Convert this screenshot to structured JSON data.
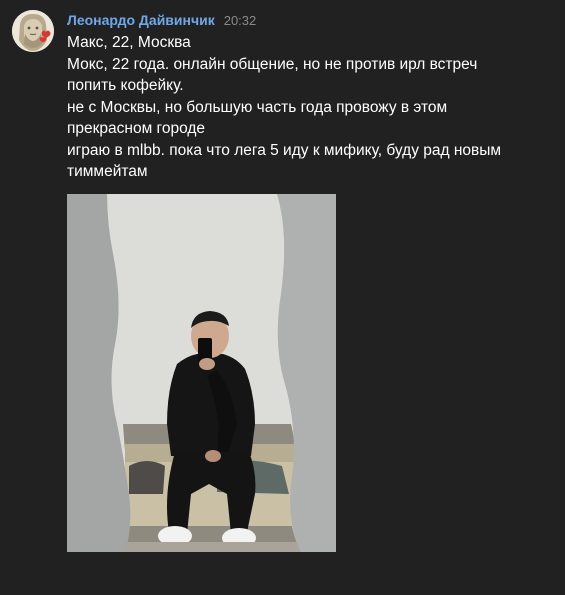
{
  "message": {
    "author": "Леонардо Дайвинчик",
    "time": "20:32",
    "lines": [
      "Макс, 22, Москва",
      "Мокс, 22 года. онлайн общение, но не против ирл встреч",
      "попить кофейку.",
      "не с Москвы, но большую часть года провожу в этом",
      "прекрасном городе",
      "играю в mlbb. пока что лега 5 иду к мифику, буду рад новым",
      "тиммейтам"
    ],
    "avatar_icon": "leonardo-portrait-icon",
    "photo_description_icon": "mirror-selfie-photo"
  },
  "colors": {
    "background": "#212121",
    "author": "#6fa8e8",
    "time": "#8a8a8a",
    "text": "#ffffff"
  }
}
